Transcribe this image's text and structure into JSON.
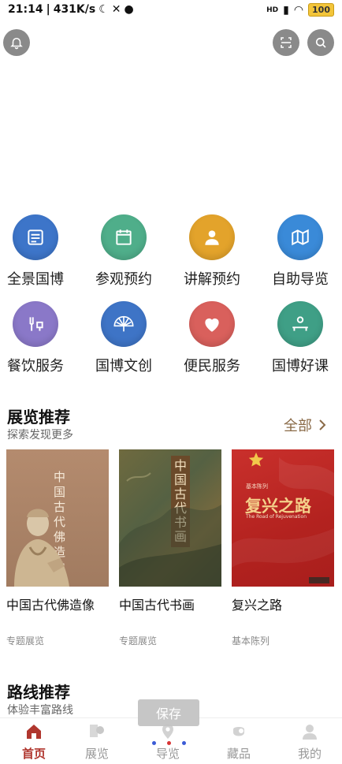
{
  "status": {
    "time": "21:14",
    "speed": "431K/s",
    "net": "HD",
    "battery": "100"
  },
  "grid": [
    {
      "label": "全景国博",
      "icon": "panorama-icon",
      "color": "#3d75c9"
    },
    {
      "label": "参观预约",
      "icon": "calendar-icon",
      "color": "#4fae8a"
    },
    {
      "label": "讲解预约",
      "icon": "guide-person-icon",
      "color": "#e3a32b"
    },
    {
      "label": "自助导览",
      "icon": "map-icon",
      "color": "#3a8ad8"
    },
    {
      "label": "餐饮服务",
      "icon": "dining-icon",
      "color": "#8a78c8"
    },
    {
      "label": "国博文创",
      "icon": "fan-icon",
      "color": "#3e74c6"
    },
    {
      "label": "便民服务",
      "icon": "heart-hand-icon",
      "color": "#d9605c"
    },
    {
      "label": "国博好课",
      "icon": "lecture-icon",
      "color": "#3f9f86"
    }
  ],
  "exhibitions": {
    "title": "展览推荐",
    "subtitle": "探索发现更多",
    "all_label": "全部",
    "cards": [
      {
        "title": "中国古代佛造像",
        "tag": "专题展览",
        "cover_text": "中国古代佛造像"
      },
      {
        "title": "中国古代书画",
        "tag": "专题展览",
        "cover_text": "中国古代书画"
      },
      {
        "title": "复兴之路",
        "tag": "基本陈列",
        "cover_text": "复兴之路",
        "cover_sub": "The Road of Rejuvenation",
        "cover_label": "基本陈列"
      }
    ]
  },
  "routes": {
    "title": "路线推荐",
    "subtitle": "体验丰富路线"
  },
  "toast": "保存",
  "tabs": [
    {
      "label": "首页",
      "icon": "home-icon"
    },
    {
      "label": "展览",
      "icon": "exhibition-icon"
    },
    {
      "label": "导览",
      "icon": "navigation-icon"
    },
    {
      "label": "藏品",
      "icon": "collection-icon"
    },
    {
      "label": "我的",
      "icon": "profile-icon"
    }
  ]
}
